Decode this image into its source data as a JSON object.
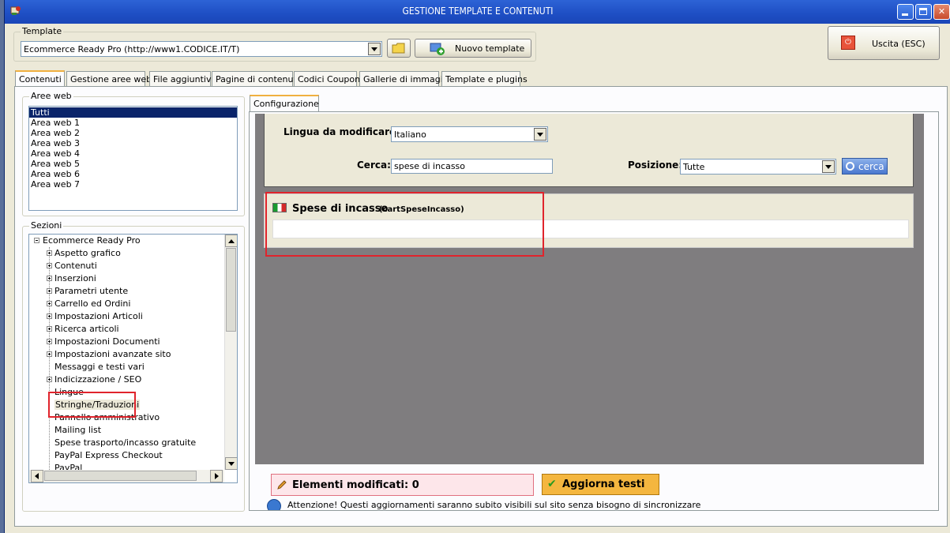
{
  "window": {
    "title": "GESTIONE TEMPLATE E CONTENUTI"
  },
  "template_group": {
    "label": "Template",
    "selected": "Ecommerce Ready Pro (http://www1.CODICE.IT/T)",
    "new_button": "Nuovo template"
  },
  "exit_button": "Uscita (ESC)",
  "tabs": [
    "Contenuti",
    "Gestione aree web",
    "File aggiuntivi",
    "Pagine di contenuti",
    "Codici Coupon",
    "Gallerie di immagini",
    "Template e plugins"
  ],
  "aree_web": {
    "label": "Aree web",
    "items": [
      "Tutti",
      "Area web 1",
      "Area web 2",
      "Area web 3",
      "Area web 4",
      "Area web 5",
      "Area web 6",
      "Area web 7"
    ]
  },
  "sezioni": {
    "label": "Sezioni",
    "root": "Ecommerce Ready Pro",
    "items": [
      "Aspetto grafico",
      "Contenuti",
      "Inserzioni",
      "Parametri utente",
      "Carrello ed Ordini",
      "Impostazioni Articoli",
      "Ricerca articoli",
      "Impostazioni Documenti",
      "Impostazioni avanzate sito",
      "Messaggi e testi vari",
      "Indicizzazione / SEO",
      "Lingue",
      "Stringhe/Traduzioni",
      "Pannello amministrativo",
      "Mailing list",
      "Spese trasporto/incasso gratuite",
      "PayPal Express Checkout",
      "PayPal"
    ]
  },
  "config": {
    "tab": "Configurazione",
    "lingua_label": "Lingua da modificare:",
    "lingua_value": "Italiano",
    "cerca_label": "Cerca:",
    "cerca_value": "spese di incasso",
    "posizione_label": "Posizione:",
    "posizione_value": "Tutte",
    "cerca_button": "cerca"
  },
  "string_entry": {
    "title": "Spese di incasso",
    "key": "(cartSpeseIncasso)",
    "value": ""
  },
  "footer": {
    "modified": "Elementi modificati: 0",
    "update_button": "Aggiorna testi",
    "notice": "Attenzione! Questi aggiornamenti saranno subito visibili sul sito senza bisogno di sincronizzare"
  },
  "colors": {
    "accent_red": "#e0242c",
    "update_button": "#f4b63f",
    "selection": "#0a246a"
  }
}
